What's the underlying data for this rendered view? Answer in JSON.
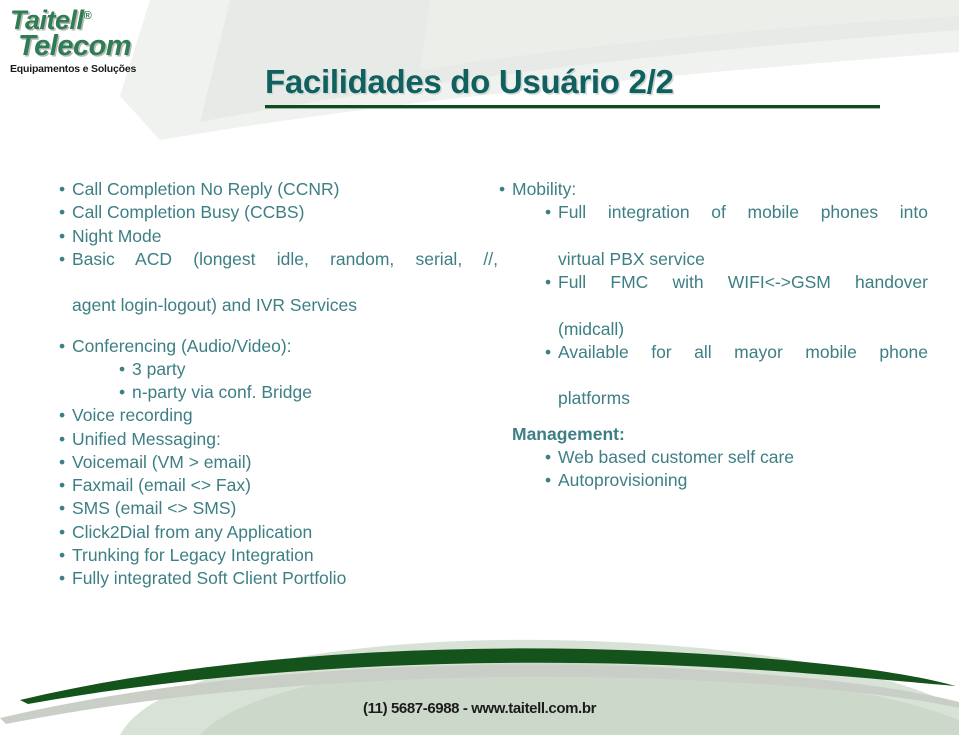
{
  "logo": {
    "brand": "Taitell",
    "registered": "®",
    "product": "Telecom",
    "tagline": "Equipamentos e Soluções"
  },
  "title": "Facilidades do Usuário 2/2",
  "bullet_glyph": "•",
  "left_column": [
    {
      "level": 1,
      "text": "Call Completion No Reply (CCNR)"
    },
    {
      "level": 1,
      "text": "Call Completion Busy (CCBS)"
    },
    {
      "level": 1,
      "text": "Night Mode"
    },
    {
      "level": 1,
      "text": "Basic ACD (longest idle, random, serial, //,"
    },
    {
      "level": 0,
      "text": "agent login-logout) and IVR Services"
    },
    {
      "level": 1,
      "text": "Conferencing (Audio/Video):"
    },
    {
      "level": 2,
      "text": "3 party"
    },
    {
      "level": 2,
      "text": "n-party via conf. Bridge"
    },
    {
      "level": 1,
      "text": "Voice recording"
    },
    {
      "level": 1,
      "text": "Unified Messaging:"
    },
    {
      "level": 1,
      "text": "Voicemail (VM > email)"
    },
    {
      "level": 1,
      "text": "Faxmail (email <> Fax)"
    },
    {
      "level": 1,
      "text": "SMS (email <> SMS)"
    },
    {
      "level": 1,
      "text": "Click2Dial from any Application"
    },
    {
      "level": 1,
      "text": "Trunking for Legacy Integration"
    },
    {
      "level": 1,
      "text": "Fully integrated Soft Client Portfolio"
    }
  ],
  "right_column": {
    "mobility_heading": "Mobility:",
    "mobility_items": [
      {
        "text": "Full integration of mobile phones into",
        "justified": true
      },
      {
        "text": "virtual PBX service",
        "continuation": true
      },
      {
        "text": "Full FMC with WIFI<->GSM handover",
        "justified": true
      },
      {
        "text": "(midcall)",
        "continuation": true
      },
      {
        "text": "Available for all mayor mobile phone",
        "justified": true
      },
      {
        "text": "platforms",
        "continuation": true
      }
    ],
    "management_heading": "Management:",
    "management_items": [
      "Web based customer self care",
      "Autoprovisioning"
    ]
  },
  "footer": "(11) 5687-6988 - www.taitell.com.br",
  "colors": {
    "title": "#116060",
    "body": "#3d7f84",
    "rule": "#0f4b1e",
    "swoosh_dark": "#14531b",
    "swoosh_light": "#c6d6c4",
    "logo_green": "#2f7d52",
    "background": "#ffffff"
  }
}
